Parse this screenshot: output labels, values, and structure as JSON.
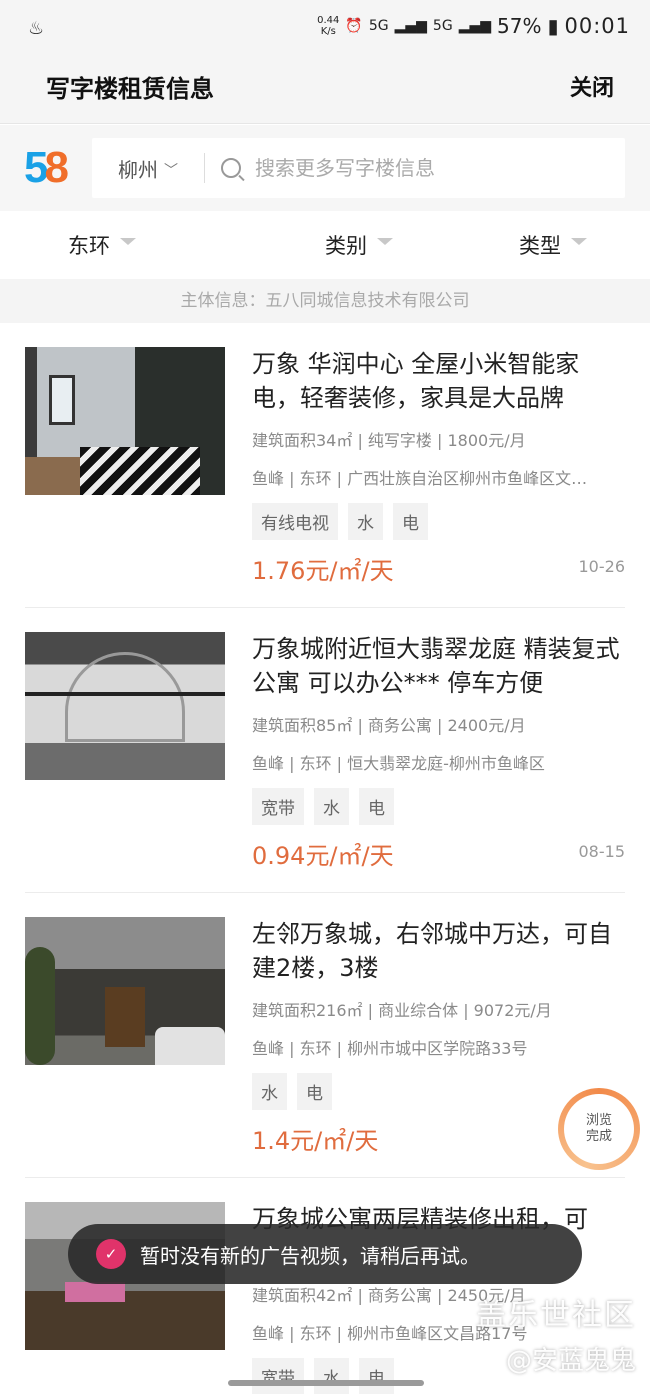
{
  "status_bar": {
    "net_speed_value": "0.44",
    "net_speed_unit": "K/s",
    "network_1": "5G",
    "network_2": "5G",
    "battery": "57%",
    "time": "00:01"
  },
  "header": {
    "title": "写字楼租赁信息",
    "close_label": "关闭"
  },
  "search": {
    "logo_text_1": "5",
    "logo_text_2": "8",
    "city": "柳州",
    "placeholder": "搜索更多写字楼信息"
  },
  "filters": [
    "东环",
    "类别",
    "类型"
  ],
  "subject_info": "主体信息：五八同城信息技术有限公司",
  "listings": [
    {
      "title": "万象 华润中心 全屋小米智能家电，轻奢装修，家具是大品牌",
      "meta1": "建筑面积34㎡ | 纯写字楼 | 1800元/月",
      "meta2": "鱼峰 | 东环 | 广西壮族自治区柳州市鱼峰区文…",
      "tags": [
        "有线电视",
        "水",
        "电"
      ],
      "price": "1.76元/㎡/天",
      "date": "10-26"
    },
    {
      "title": "万象城附近恒大翡翠龙庭 精装复式公寓 可以办公*** 停车方便",
      "meta1": "建筑面积85㎡ | 商务公寓 | 2400元/月",
      "meta2": "鱼峰 | 东环 | 恒大翡翠龙庭-柳州市鱼峰区",
      "tags": [
        "宽带",
        "水",
        "电"
      ],
      "price": "0.94元/㎡/天",
      "date": "08-15"
    },
    {
      "title": "左邻万象城，右邻城中万达，可自建2楼，3楼",
      "meta1": "建筑面积216㎡ | 商业综合体 | 9072元/月",
      "meta2": "鱼峰 | 东环 | 柳州市城中区学院路33号",
      "tags": [
        "水",
        "电"
      ],
      "price": "1.4元/㎡/天",
      "date": ""
    },
    {
      "title": "万象城公寓两层精装修出租，可",
      "meta1": "建筑面积42㎡ | 商务公寓 | 2450元/月",
      "meta2": "鱼峰 | 东环 | 柳州市鱼峰区文昌路17号",
      "tags": [
        "宽带",
        "水",
        "电"
      ],
      "price": "",
      "date": ""
    }
  ],
  "toast": {
    "icon": "check-icon",
    "text": "暂时没有新的广告视频，请稍后再试。"
  },
  "badge": {
    "line1": "浏览",
    "line2": "完成"
  },
  "watermark": {
    "line1": "盖乐世社区",
    "line2": "@安蓝鬼鬼"
  },
  "colors": {
    "price": "#e06c3e",
    "toast_icon": "#e0336a",
    "badge_ring": "#f28a4a"
  }
}
